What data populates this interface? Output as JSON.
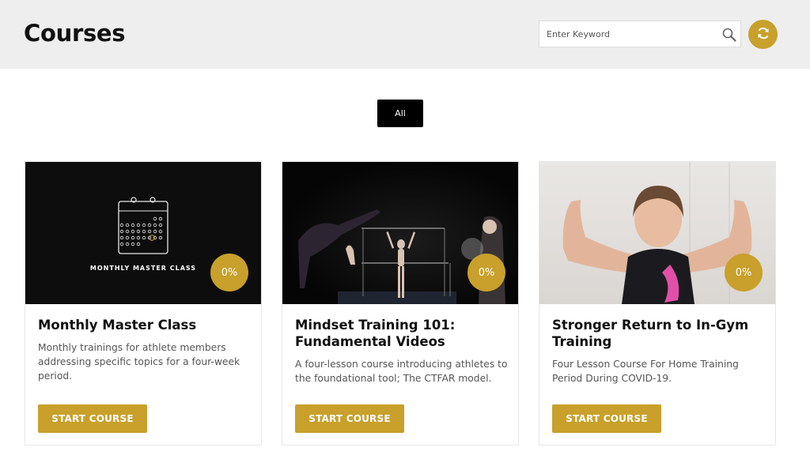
{
  "header": {
    "title": "Courses",
    "search_placeholder": "Enter Keyword",
    "search_icon": "search-icon",
    "refresh_icon": "refresh-icon"
  },
  "filters": {
    "all_label": "All"
  },
  "colors": {
    "accent": "#c8a02b",
    "header_bg": "#eeeeee",
    "filter_active": "#000000"
  },
  "courses": [
    {
      "title": "Monthly Master Class",
      "description": "Monthly trainings for athlete members addressing specific topics for a four-week period.",
      "progress": "0%",
      "image_caption": "MONTHLY MASTER CLASS",
      "button_label": "START COURSE"
    },
    {
      "title": "Mindset Training 101: Fundamental Videos",
      "description": "A four-lesson course introducing athletes to the foundational tool; The CTFAR model.",
      "progress": "0%",
      "button_label": "START COURSE"
    },
    {
      "title": "Stronger Return to In-Gym Training",
      "description": "Four Lesson Course For Home Training Period During COVID-19.",
      "progress": "0%",
      "button_label": "START COURSE"
    }
  ]
}
